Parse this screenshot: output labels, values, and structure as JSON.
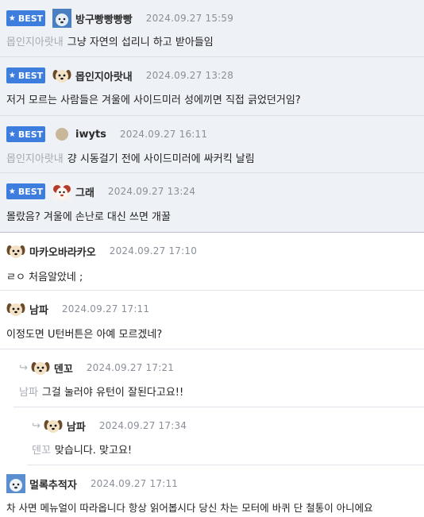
{
  "badge_label": "BEST",
  "comments": [
    {
      "nick": "방구빵빵빵빵",
      "date": "2024.09.27 15:59",
      "mention": "몹인지아랏내",
      "text": "그냥 자연의 섭리니 하고 받아들임"
    },
    {
      "nick": "몹인지아랏내",
      "date": "2024.09.27 13:28",
      "text": "저거 모르는 사람들은 겨울에 사이드미러 성에끼면 직접 긁었던거임?"
    },
    {
      "nick": "iwyts",
      "date": "2024.09.27 16:11",
      "mention": "몹인지아랏내",
      "text": "걍 시동걸기 전에 사이드미러에 싸커킥 날림"
    },
    {
      "nick": "그래",
      "date": "2024.09.27 13:24",
      "text": "몰랐음? 겨울에 손난로 대신 쓰면 개꿀"
    },
    {
      "nick": "마카오바라카오",
      "date": "2024.09.27 17:10",
      "text": "ㄹㅇ 처음알았네 ;"
    },
    {
      "nick": "남파",
      "date": "2024.09.27 17:11",
      "text": "이정도면 U턴버튼은 아예 모르겠네?"
    },
    {
      "nick": "덴꼬",
      "date": "2024.09.27 17:21",
      "mention": "남파",
      "text": "그걸 눌러야 유턴이 잘된다고요!!"
    },
    {
      "nick": "남파",
      "date": "2024.09.27 17:34",
      "mention": "덴꼬",
      "text": "맞습니다. 맞고요!"
    },
    {
      "nick": "멀록추적자",
      "date": "2024.09.27 17:11",
      "text": "차 사면 메뉴얼이 따라옵니다 항상 읽어봅시다 당신 차는 모터에 바퀴 단 철통이 아니에요"
    }
  ],
  "icons": {
    "best_star": "star-icon",
    "reply": "reply-arrow-icon"
  },
  "colors": {
    "best_badge": "#3d7ddd",
    "best_background": "#eef1f6",
    "mention": "#a6abb3",
    "date": "#8a8f99"
  }
}
